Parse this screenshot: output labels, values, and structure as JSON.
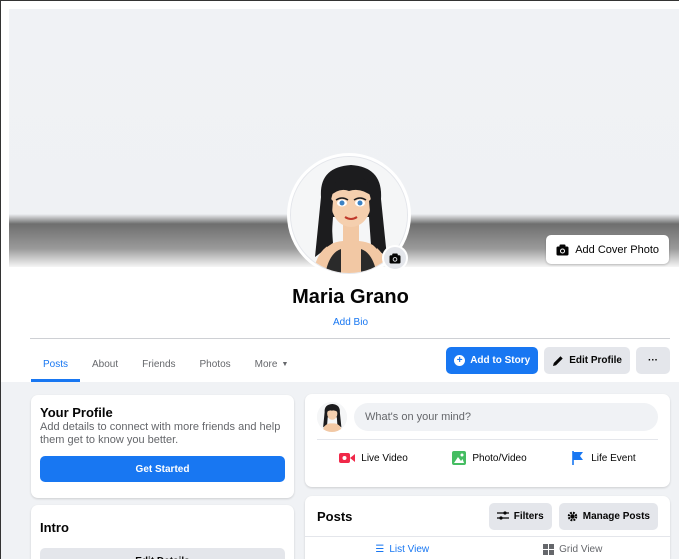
{
  "profile": {
    "name": "Maria Grano",
    "add_bio": "Add Bio",
    "add_cover_photo": "Add Cover Photo"
  },
  "nav": {
    "tabs": [
      {
        "label": "Posts",
        "active": true
      },
      {
        "label": "About"
      },
      {
        "label": "Friends"
      },
      {
        "label": "Photos"
      },
      {
        "label": "More"
      }
    ],
    "add_to_story": "Add to Story",
    "edit_profile": "Edit Profile",
    "more": "···"
  },
  "your_profile": {
    "title": "Your Profile",
    "description": "Add details to connect with more friends and help them get to know you better.",
    "button": "Get Started"
  },
  "intro": {
    "title": "Intro",
    "button": "Edit Details"
  },
  "composer": {
    "placeholder": "What's on your mind?",
    "actions": [
      "Live Video",
      "Photo/Video",
      "Life Event"
    ]
  },
  "posts": {
    "title": "Posts",
    "filters": "Filters",
    "manage": "Manage Posts",
    "list_view": "List View",
    "grid_view": "Grid View"
  },
  "colors": {
    "accent": "#1877f2",
    "live_video": "#f02849",
    "photo_video": "#45bd62",
    "life_event": "#1877f2"
  }
}
